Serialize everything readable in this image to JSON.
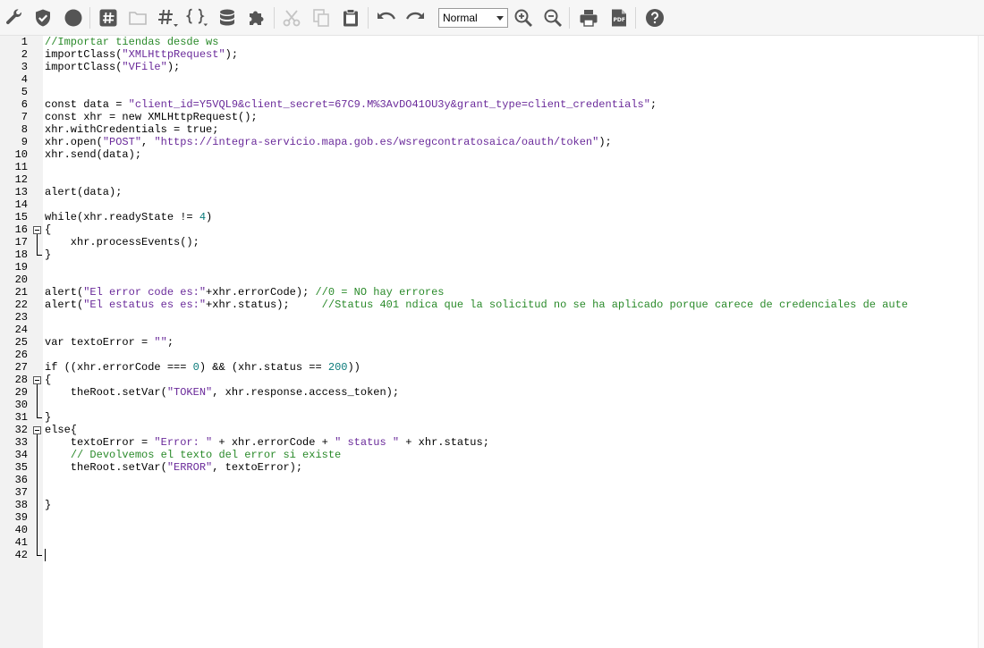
{
  "toolbar": {
    "style_select": {
      "value": "Normal"
    },
    "icons": [
      "wrench-icon",
      "shield-check-icon",
      "circle-icon",
      "hash-icon",
      "folder-icon",
      "hash-dropdown-icon",
      "braces-dropdown-icon",
      "database-icon",
      "puzzle-icon",
      "cut-icon",
      "copy-icon",
      "paste-icon",
      "undo-icon",
      "redo-icon",
      "zoom-in-icon",
      "zoom-out-icon",
      "print-icon",
      "pdf-icon",
      "help-icon"
    ]
  },
  "editor": {
    "lines": [
      {
        "n": "1",
        "parts": [
          {
            "t": "//Importar tiendas desde ws",
            "c": "com"
          }
        ]
      },
      {
        "n": "2",
        "parts": [
          {
            "t": "importClass("
          },
          {
            "t": "\"XMLHttpRequest\"",
            "c": "str"
          },
          {
            "t": ");"
          }
        ]
      },
      {
        "n": "3",
        "parts": [
          {
            "t": "importClass("
          },
          {
            "t": "\"VFile\"",
            "c": "str"
          },
          {
            "t": ");"
          }
        ]
      },
      {
        "n": "4",
        "parts": []
      },
      {
        "n": "5",
        "parts": []
      },
      {
        "n": "6",
        "parts": [
          {
            "t": "const data = "
          },
          {
            "t": "\"client_id=Y5VQL9&client_secret=67C9.M%3AvDO41OU3y&grant_type=client_credentials\"",
            "c": "str"
          },
          {
            "t": ";"
          }
        ]
      },
      {
        "n": "7",
        "parts": [
          {
            "t": "const xhr = new XMLHttpRequest();"
          }
        ]
      },
      {
        "n": "8",
        "parts": [
          {
            "t": "xhr.withCredentials = true;"
          }
        ]
      },
      {
        "n": "9",
        "parts": [
          {
            "t": "xhr.open("
          },
          {
            "t": "\"POST\"",
            "c": "str"
          },
          {
            "t": ", "
          },
          {
            "t": "\"https://integra-servicio.mapa.gob.es/wsregcontratosaica/oauth/token\"",
            "c": "str"
          },
          {
            "t": ");"
          }
        ]
      },
      {
        "n": "10",
        "parts": [
          {
            "t": "xhr.send(data);"
          }
        ]
      },
      {
        "n": "11",
        "parts": []
      },
      {
        "n": "12",
        "parts": []
      },
      {
        "n": "13",
        "parts": [
          {
            "t": "alert(data);"
          }
        ]
      },
      {
        "n": "14",
        "parts": []
      },
      {
        "n": "15",
        "parts": [
          {
            "t": "while(xhr.readyState != "
          },
          {
            "t": "4",
            "c": "num"
          },
          {
            "t": ")"
          }
        ]
      },
      {
        "n": "16",
        "parts": [
          {
            "t": "{"
          }
        ]
      },
      {
        "n": "17",
        "parts": [
          {
            "t": "    xhr.processEvents();"
          }
        ]
      },
      {
        "n": "18",
        "parts": [
          {
            "t": "}"
          }
        ]
      },
      {
        "n": "19",
        "parts": []
      },
      {
        "n": "20",
        "parts": []
      },
      {
        "n": "21",
        "parts": [
          {
            "t": "alert("
          },
          {
            "t": "\"El error code es:\"",
            "c": "str"
          },
          {
            "t": "+xhr.errorCode); "
          },
          {
            "t": "//0 = NO hay errores",
            "c": "com"
          }
        ]
      },
      {
        "n": "22",
        "parts": [
          {
            "t": "alert("
          },
          {
            "t": "\"El estatus es es:\"",
            "c": "str"
          },
          {
            "t": "+xhr.status);     "
          },
          {
            "t": "//Status 401 ndica que la solicitud no se ha aplicado porque carece de credenciales de aute",
            "c": "com"
          }
        ]
      },
      {
        "n": "23",
        "parts": []
      },
      {
        "n": "24",
        "parts": []
      },
      {
        "n": "25",
        "parts": [
          {
            "t": "var textoError = "
          },
          {
            "t": "\"\"",
            "c": "str"
          },
          {
            "t": ";"
          }
        ]
      },
      {
        "n": "26",
        "parts": []
      },
      {
        "n": "27",
        "parts": [
          {
            "t": "if ((xhr.errorCode === "
          },
          {
            "t": "0",
            "c": "num"
          },
          {
            "t": ") && (xhr.status == "
          },
          {
            "t": "200",
            "c": "num"
          },
          {
            "t": "))"
          }
        ]
      },
      {
        "n": "28",
        "parts": [
          {
            "t": "{"
          }
        ]
      },
      {
        "n": "29",
        "parts": [
          {
            "t": "    theRoot.setVar("
          },
          {
            "t": "\"TOKEN\"",
            "c": "str"
          },
          {
            "t": ", xhr.response.access_token);"
          }
        ]
      },
      {
        "n": "30",
        "parts": []
      },
      {
        "n": "31",
        "parts": [
          {
            "t": "}"
          }
        ]
      },
      {
        "n": "32",
        "parts": [
          {
            "t": "else{"
          }
        ]
      },
      {
        "n": "33",
        "parts": [
          {
            "t": "    textoError = "
          },
          {
            "t": "\"Error: \"",
            "c": "str"
          },
          {
            "t": " + xhr.errorCode + "
          },
          {
            "t": "\" status \"",
            "c": "str"
          },
          {
            "t": " + xhr.status;"
          }
        ]
      },
      {
        "n": "34",
        "parts": [
          {
            "t": "    "
          },
          {
            "t": "// Devolvemos el texto del error si existe",
            "c": "com"
          }
        ]
      },
      {
        "n": "35",
        "parts": [
          {
            "t": "    theRoot.setVar("
          },
          {
            "t": "\"ERROR\"",
            "c": "str"
          },
          {
            "t": ", textoError);"
          }
        ]
      },
      {
        "n": "36",
        "parts": []
      },
      {
        "n": "37",
        "parts": []
      },
      {
        "n": "38",
        "parts": [
          {
            "t": "}"
          }
        ]
      },
      {
        "n": "39",
        "parts": []
      },
      {
        "n": "40",
        "parts": []
      },
      {
        "n": "41",
        "parts": []
      },
      {
        "n": "42",
        "parts": []
      }
    ]
  }
}
